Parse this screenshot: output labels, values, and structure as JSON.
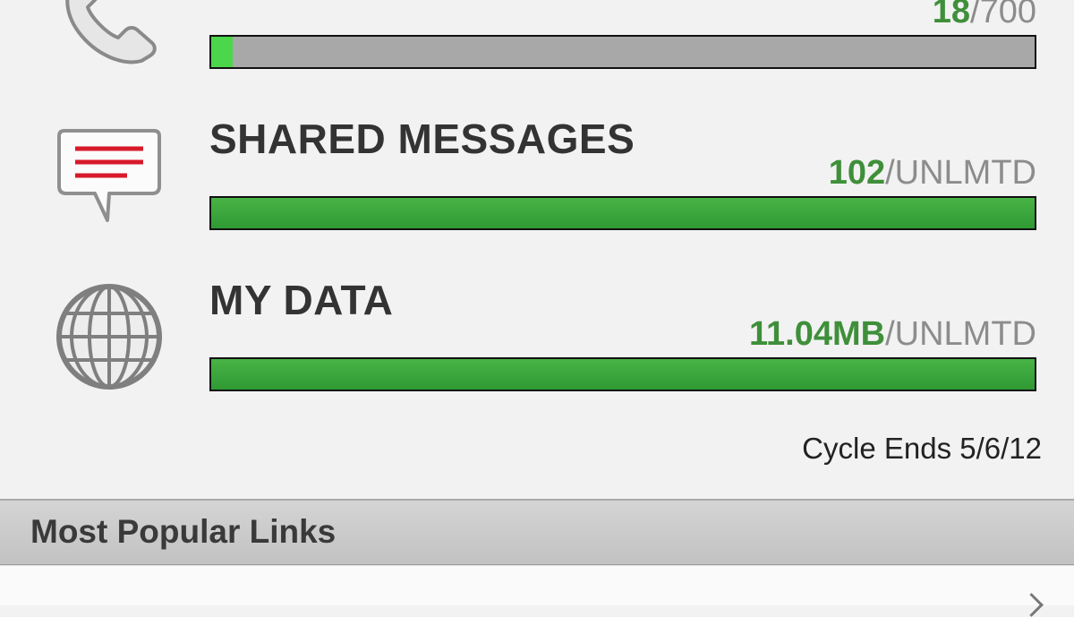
{
  "usage": {
    "minutes": {
      "icon": "phone-icon",
      "used": "18",
      "limit": "/700",
      "fraction": 0.0257
    },
    "messages": {
      "icon": "message-bubble-icon",
      "title": "SHARED MESSAGES",
      "used": "102",
      "limit": "/UNLMTD",
      "fraction": 1.0
    },
    "data": {
      "icon": "globe-icon",
      "title": "MY DATA",
      "used": "11.04MB",
      "limit": "/UNLMTD",
      "fraction": 1.0
    }
  },
  "cycle_ends": "Cycle Ends 5/6/12",
  "popular_links": {
    "header": "Most Popular Links"
  },
  "colors": {
    "used_value": "#3f8f3a",
    "bar_fill": "#2f9a33",
    "bar_track": "#a8a8a8",
    "minutes_fill": "#4cd64c"
  }
}
